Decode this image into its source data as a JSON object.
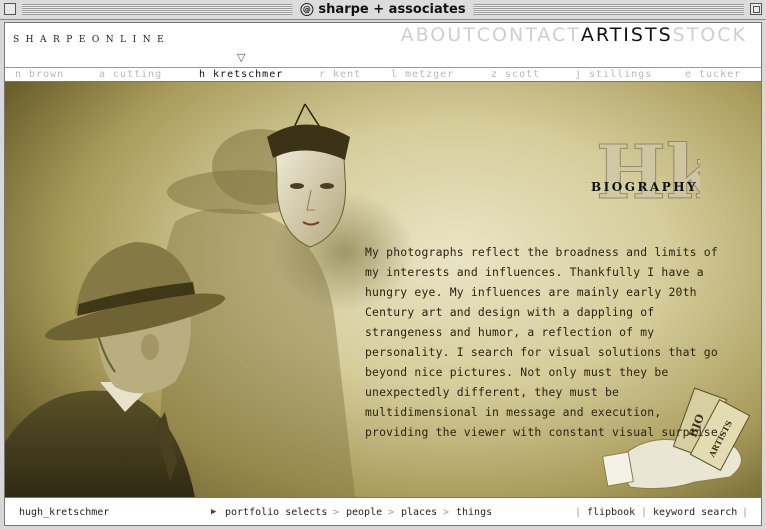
{
  "window": {
    "title": "sharpe + associates"
  },
  "site": {
    "logo": "SHARPEONLINE",
    "topnav": [
      {
        "label": "ABOUT",
        "active": false
      },
      {
        "label": "CONTACT",
        "active": false
      },
      {
        "label": "ARTISTS",
        "active": true
      },
      {
        "label": "STOCK",
        "active": false
      }
    ]
  },
  "artists": [
    {
      "label": "n brown",
      "active": false
    },
    {
      "label": "a cutting",
      "active": false
    },
    {
      "label": "h kretschmer",
      "active": true
    },
    {
      "label": "r kent",
      "active": false
    },
    {
      "label": "l metzger",
      "active": false
    },
    {
      "label": "z scott",
      "active": false
    },
    {
      "label": "j stillings",
      "active": false
    },
    {
      "label": "e tucker",
      "active": false
    }
  ],
  "bio": {
    "monogram": "Hk",
    "title": "BIOGRAPHY",
    "text": "My photographs reflect the broadness and limits of my interests and influences. Thankfully I have a hungry eye. My influences are mainly early 20th Century art and design with a dappling of strangeness and humor, a reflection of my personality. I search for visual solutions that go beyond nice pictures. Not only must they be unexpectedly different, they must be multidimensional in message and execution, providing the viewer with constant visual surprise.",
    "tickets": [
      "BIO",
      "ARTISTS"
    ]
  },
  "footer": {
    "artist": "hugh_kretschmer",
    "links": [
      "portfolio selects",
      "people",
      "places",
      "things"
    ],
    "separator": ">",
    "right_links": [
      "flipbook",
      "keyword search"
    ],
    "bar": "|"
  },
  "colors": {
    "sepia_light": "#e9e4c4",
    "sepia_dark": "#6b5f2c",
    "active_text": "#111111",
    "inactive_text": "#cfcfcf",
    "accent": "#8a2a2a"
  }
}
